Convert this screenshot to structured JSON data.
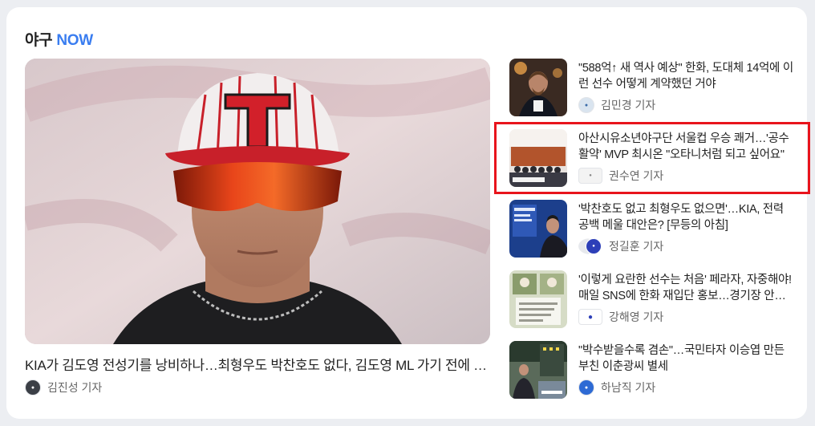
{
  "section": {
    "title_main": "야구",
    "title_accent": "NOW"
  },
  "main_article": {
    "headline": "KIA가 김도영 전성기를 낭비하나…최형우도 박찬호도 없다, 김도영 ML 가기 전에 KS 우…",
    "reporter": "김진성 기자",
    "image": "baseball-player-portrait"
  },
  "side_articles": [
    {
      "title": "\"588억↑ 새 역사 예상\" 한화, 도대체 14억에 이런 선수 어떻게 계약했던 거야",
      "reporter": "김민경 기자",
      "thumb": "player-on-stage-thumbnail"
    },
    {
      "title": "아산시유소년야구단 서울컵 우승 쾌거…'공수 활약' MVP 최시온 \"오타니처럼 되고 싶어요\"",
      "reporter": "권수연 기자",
      "thumb": "team-ceremony-thumbnail"
    },
    {
      "title": "'박찬호도 없고 최형우도 없으면'…KIA, 전력 공백 메울 대안은? [무등의 아침]",
      "reporter": "정길훈 기자",
      "thumb": "broadcast-anchor-thumbnail"
    },
    {
      "title": "'이렇게 요란한 선수는 처음' 페라자, 자중해야! 매일 SNS에 한화 재입단 홍보…경기장 안에…",
      "reporter": "강해영 기자",
      "thumb": "sns-post-thumbnail"
    },
    {
      "title": "\"박수받을수록 겸손\"…국민타자 이승엽 만든 부친 이춘광씨 별세",
      "reporter": "하남직 기자",
      "thumb": "ballpark-scoreboard-thumbnail"
    }
  ],
  "colors": {
    "accent": "#3a7df0",
    "highlight_border": "#e8141c",
    "background": "#eceef2",
    "card": "#ffffff"
  }
}
